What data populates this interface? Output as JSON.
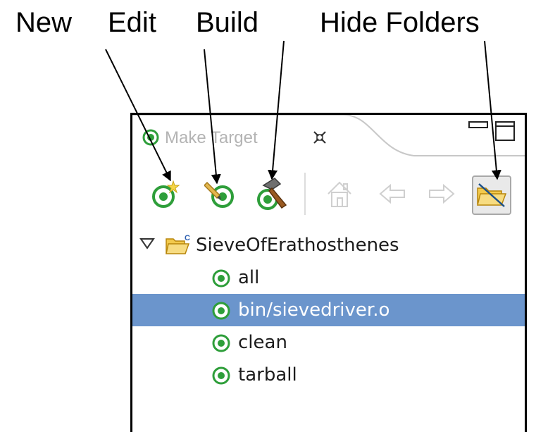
{
  "callouts": {
    "new": "New",
    "edit": "Edit",
    "build": "Build",
    "hide_folders": "Hide Folders"
  },
  "view": {
    "title": "Make Target",
    "icons": {
      "tab": "make-target-icon",
      "close": "close-icon",
      "minimize": "minimize-icon",
      "maximize": "maximize-icon"
    }
  },
  "toolbar": {
    "buttons": [
      {
        "name": "new-target-button",
        "icon": "new-target-icon"
      },
      {
        "name": "edit-target-button",
        "icon": "edit-target-icon"
      },
      {
        "name": "build-target-button",
        "icon": "hammer-icon"
      },
      {
        "name": "home-button",
        "icon": "home-icon",
        "enabled": false
      },
      {
        "name": "back-button",
        "icon": "back-arrow-icon",
        "enabled": false
      },
      {
        "name": "forward-button",
        "icon": "forward-arrow-icon",
        "enabled": false
      },
      {
        "name": "hide-folders-button",
        "icon": "hide-folders-icon",
        "pressed": true
      }
    ]
  },
  "tree": {
    "project": "SieveOfErathosthenes",
    "project_expanded": true,
    "targets": [
      {
        "label": "all",
        "selected": false
      },
      {
        "label": "bin/sievedriver.o",
        "selected": true
      },
      {
        "label": "clean",
        "selected": false
      },
      {
        "label": "tarball",
        "selected": false
      }
    ]
  },
  "colors": {
    "selection": "#6b95cc",
    "target_green": "#2e9e3a",
    "folder_yellow": "#f2c94c"
  }
}
